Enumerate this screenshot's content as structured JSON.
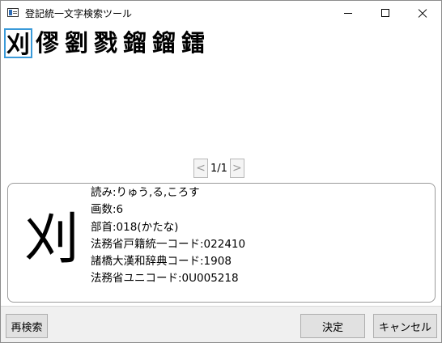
{
  "window": {
    "title": "登記統一文字検索ツール"
  },
  "icons": {
    "app": "app-window-icon",
    "minimize": "minimize-icon",
    "maximize": "maximize-icon",
    "close": "close-icon",
    "prev": "chevron-left-icon",
    "next": "chevron-right-icon"
  },
  "colors": {
    "selection_border": "#3a9ad9",
    "footer_bg": "#f0f0f0",
    "button_bg": "#e1e1e1"
  },
  "candidates": [
    "刈",
    "僇",
    "劉",
    "戮",
    "鎦",
    "鎦",
    "鐳"
  ],
  "pager": {
    "prev_glyph": "<",
    "text": "1/1",
    "next_glyph": ">"
  },
  "detail": {
    "character": "刈",
    "lines": [
      "読み:りゅう,る,ころす",
      "画数:6",
      "部首:018(かたな)",
      "法務省戸籍統一コード:022410",
      "諸橋大漢和辞典コード:1908",
      "法務省ユニコード:0U005218"
    ]
  },
  "footer": {
    "research_label": "再検索",
    "ok_label": "決定",
    "cancel_label": "キャンセル"
  }
}
